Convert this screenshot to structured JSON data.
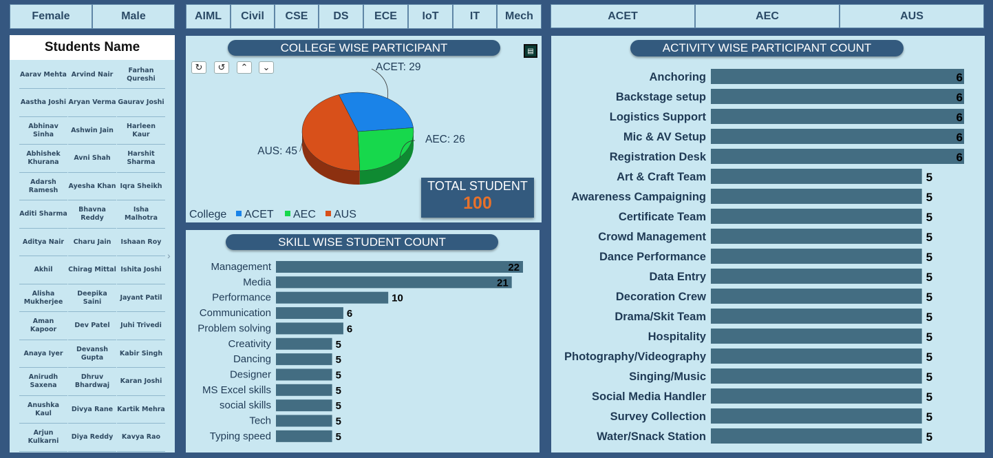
{
  "gender_filters": [
    "Female",
    "Male"
  ],
  "department_filters": [
    "AIML",
    "Civil",
    "CSE",
    "DS",
    "ECE",
    "IoT",
    "IT",
    "Mech"
  ],
  "college_filters": [
    "ACET",
    "AEC",
    "AUS"
  ],
  "students_panel": {
    "title": "Students Name",
    "names": [
      [
        "Aarav Mehta",
        "Arvind Nair",
        "Farhan Qureshi"
      ],
      [
        "Aastha Joshi",
        "Aryan Verma",
        "Gaurav Joshi"
      ],
      [
        "Abhinav Sinha",
        "Ashwin Jain",
        "Harleen Kaur"
      ],
      [
        "Abhishek Khurana",
        "Avni Shah",
        "Harshit Sharma"
      ],
      [
        "Adarsh Ramesh",
        "Ayesha Khan",
        "Iqra Sheikh"
      ],
      [
        "Aditi Sharma",
        "Bhavna Reddy",
        "Isha Malhotra"
      ],
      [
        "Aditya Nair",
        "Charu Jain",
        "Ishaan Roy"
      ],
      [
        "Akhil",
        "Chirag Mittal",
        "Ishita Joshi"
      ],
      [
        "Alisha Mukherjee",
        "Deepika Saini",
        "Jayant Patil"
      ],
      [
        "Aman Kapoor",
        "Dev Patel",
        "Juhi Trivedi"
      ],
      [
        "Anaya Iyer",
        "Devansh Gupta",
        "Kabir Singh"
      ],
      [
        "Anirudh Saxena",
        "Dhruv Bhardwaj",
        "Karan Joshi"
      ],
      [
        "Anushka Kaul",
        "Divya Rane",
        "Kartik Mehra"
      ],
      [
        "Arjun Kulkarni",
        "Diya Reddy",
        "Kavya Rao"
      ]
    ]
  },
  "college_chart": {
    "title": "COLLEGE WISE PARTICIPANT",
    "legend_title": "College",
    "labels": [
      "ACET: 29",
      "AEC: 26",
      "AUS: 45"
    ]
  },
  "total_student": {
    "label": "TOTAL STUDENT",
    "value": "100"
  },
  "skill_chart": {
    "title": "SKILL WISE STUDENT COUNT"
  },
  "activity_chart": {
    "title": "ACTIVITY WISE PARTICIPANT COUNT"
  },
  "colors": {
    "bar": "#436d82",
    "panel": "#c9e7f1",
    "background": "#355780",
    "acet": "#1a83e8",
    "aec": "#17d84c",
    "aus": "#d8501a",
    "total_value": "#e8712a"
  },
  "chart_data": [
    {
      "type": "pie",
      "categories": [
        "ACET",
        "AEC",
        "AUS"
      ],
      "values": [
        29,
        26,
        45
      ],
      "title": "COLLEGE WISE PARTICIPANT",
      "legend": "bottom-left"
    },
    {
      "type": "bar",
      "orientation": "horizontal",
      "title": "SKILL WISE STUDENT COUNT",
      "categories": [
        "Management",
        "Media",
        "Performance",
        "Communication",
        "Problem solving",
        "Creativity",
        "Dancing",
        "Designer",
        "MS Excel skills",
        "social skills",
        "Tech",
        "Typing speed"
      ],
      "values": [
        22,
        21,
        10,
        6,
        6,
        5,
        5,
        5,
        5,
        5,
        5,
        5
      ]
    },
    {
      "type": "bar",
      "orientation": "horizontal",
      "title": "ACTIVITY WISE PARTICIPANT COUNT",
      "categories": [
        "Anchoring",
        "Backstage setup",
        "Logistics Support",
        "Mic & AV Setup",
        "Registration Desk",
        "Art & Craft Team",
        "Awareness Campaigning",
        "Certificate Team",
        "Crowd Management",
        "Dance Performance",
        "Data Entry",
        "Decoration Crew",
        "Drama/Skit Team",
        "Hospitality",
        "Photography/Videography",
        "Singing/Music",
        "Social Media Handler",
        "Survey Collection",
        "Water/Snack Station"
      ],
      "values": [
        6,
        6,
        6,
        6,
        6,
        5,
        5,
        5,
        5,
        5,
        5,
        5,
        5,
        5,
        5,
        5,
        5,
        5,
        5
      ]
    }
  ]
}
